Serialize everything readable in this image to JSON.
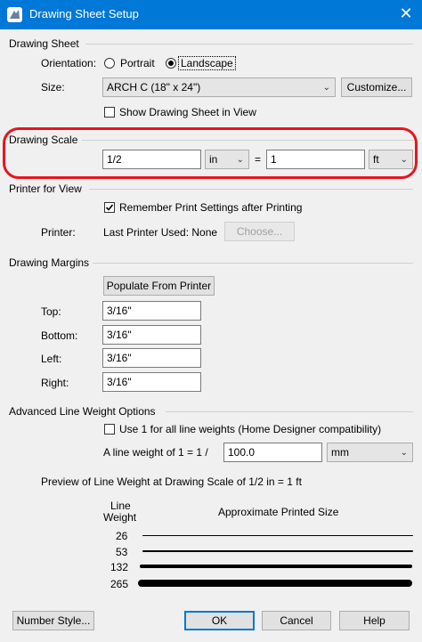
{
  "window": {
    "title": "Drawing Sheet Setup",
    "close_glyph": "✕"
  },
  "drawing_sheet": {
    "group_label": "Drawing Sheet",
    "orientation_label": "Orientation:",
    "portrait_label": "Portrait",
    "landscape_label": "Landscape",
    "orientation_selected": "Landscape",
    "size_label": "Size:",
    "size_value": "ARCH C  (18\" x 24\")",
    "customize_label": "Customize...",
    "show_in_view_label": "Show Drawing Sheet in View",
    "show_in_view_checked": false
  },
  "drawing_scale": {
    "group_label": "Drawing Scale",
    "left_value": "1/2",
    "left_unit": "in",
    "equals": "=",
    "right_value": "1",
    "right_unit": "ft",
    "highlight_color": "#e8141c"
  },
  "printer": {
    "group_label": "Printer for View",
    "remember_label": "Remember Print Settings after Printing",
    "remember_checked": true,
    "printer_label": "Printer:",
    "printer_value": "Last Printer Used: None",
    "choose_label": "Choose..."
  },
  "margins": {
    "group_label": "Drawing Margins",
    "populate_label": "Populate From Printer",
    "top_label": "Top:",
    "top_value": "3/16\"",
    "bottom_label": "Bottom:",
    "bottom_value": "3/16\"",
    "left_label": "Left:",
    "left_value": "3/16\"",
    "right_label": "Right:",
    "right_value": "3/16\""
  },
  "line_weight": {
    "group_label": "Advanced Line Weight Options",
    "use1_label": "Use 1 for all line weights (Home Designer compatibility)",
    "use1_checked": false,
    "weight_label": "A line weight of 1 = 1 /",
    "weight_value": "100.0",
    "weight_unit": "mm",
    "preview_title": "Preview of Line Weight at Drawing Scale of  1/2 in = 1 ft",
    "col_weight": "Line\nWeight",
    "col_weight_1": "Line",
    "col_weight_2": "Weight",
    "col_size": "Approximate Printed Size",
    "rows": [
      {
        "weight": "26",
        "thickness_px": 1
      },
      {
        "weight": "53",
        "thickness_px": 2
      },
      {
        "weight": "132",
        "thickness_px": 4
      },
      {
        "weight": "265",
        "thickness_px": 8
      }
    ]
  },
  "footer": {
    "number_style_label": "Number Style...",
    "ok_label": "OK",
    "cancel_label": "Cancel",
    "help_label": "Help"
  }
}
